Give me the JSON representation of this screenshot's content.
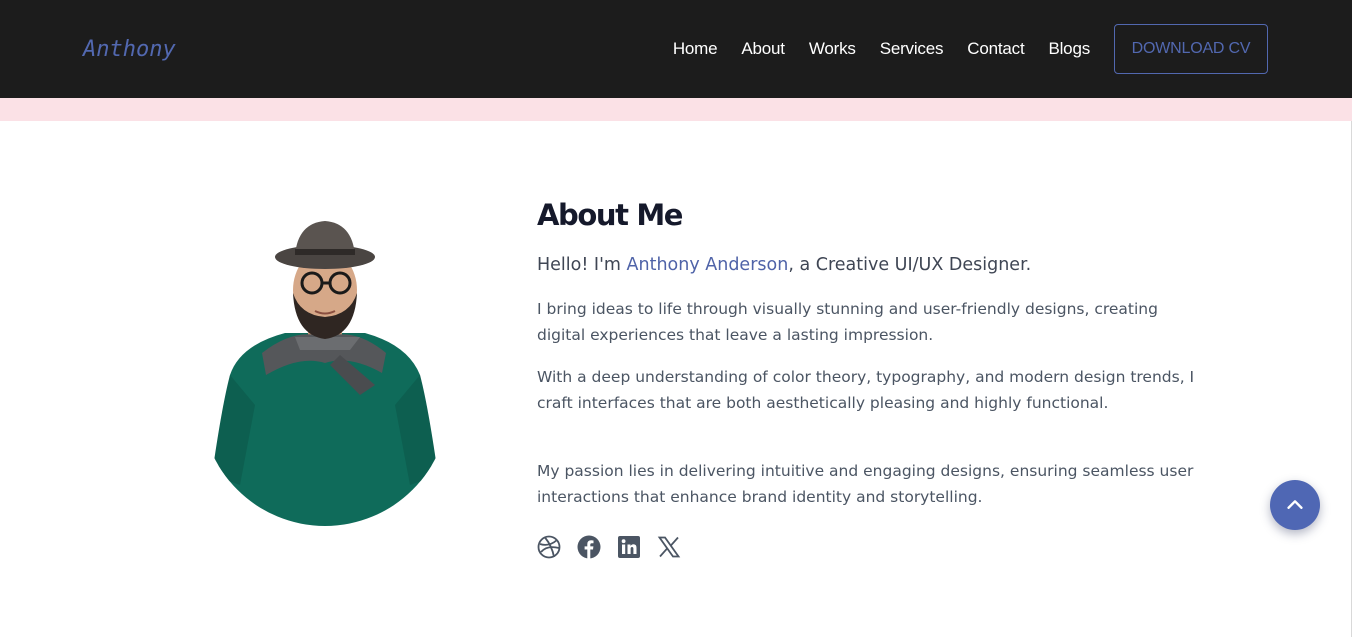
{
  "nav": {
    "brand": "Anthony",
    "links": [
      "Home",
      "About",
      "Works",
      "Services",
      "Contact",
      "Blogs"
    ],
    "cv_button": "DOWNLOAD CV"
  },
  "about": {
    "title": "About Me",
    "intro_prefix": "Hello! I'm ",
    "intro_name": "Anthony Anderson",
    "intro_suffix": ", a Creative UI/UX Designer.",
    "paragraphs": [
      "I bring ideas to life through visually stunning and user-friendly designs, creating digital experiences that leave a lasting impression.",
      "With a deep understanding of color theory, typography, and modern design trends, I craft interfaces that are both aesthetically pleasing and highly functional.",
      "My passion lies in delivering intuitive and engaging designs, ensuring seamless user interactions that enhance brand identity and storytelling."
    ],
    "socials": [
      "dribbble-icon",
      "facebook-icon",
      "linkedin-icon",
      "x-icon"
    ]
  },
  "scroll_top": {
    "icon": "chevron-up-icon"
  },
  "colors": {
    "navbar_bg": "#1c1c1c",
    "accent": "#5268b0",
    "strip": "#fbe1e6",
    "heading": "#15192b",
    "body_text": "#4b5563",
    "sweater": "#0f6b5a"
  }
}
